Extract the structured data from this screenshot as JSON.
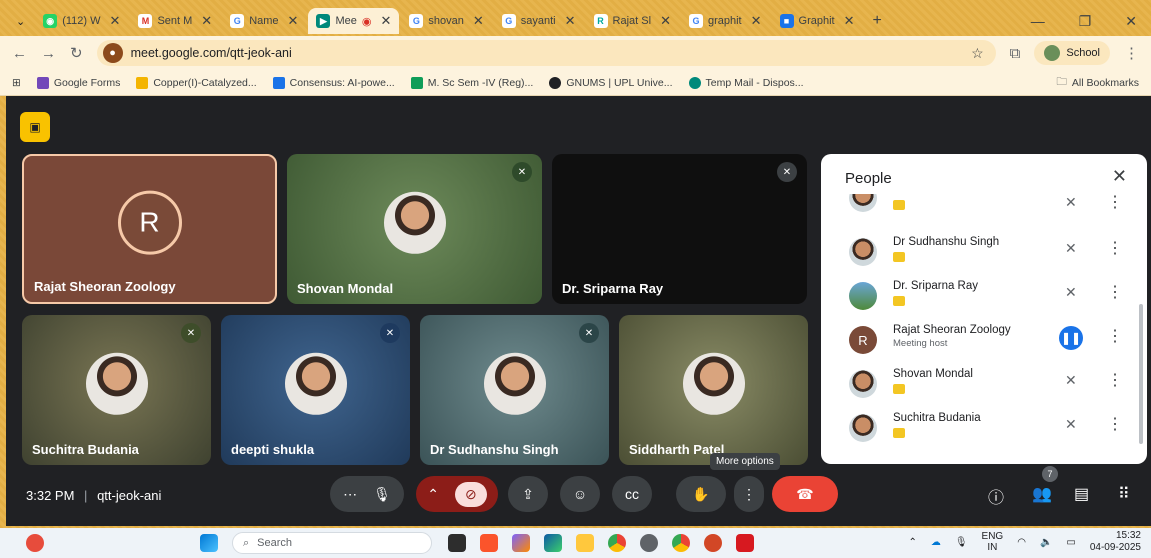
{
  "browser": {
    "tabs": [
      {
        "label": "(112) W",
        "icon": "whatsapp-icon",
        "color": "#25d366"
      },
      {
        "label": "Sent M",
        "icon": "gmail-icon",
        "color": "#d93025"
      },
      {
        "label": "Name",
        "icon": "google-icon",
        "color": "#4285f4"
      },
      {
        "label": "Mee",
        "icon": "meet-icon",
        "color": "#00897b",
        "active": true
      },
      {
        "label": "shovan",
        "icon": "google-icon",
        "color": "#4285f4"
      },
      {
        "label": "sayanti",
        "icon": "google-icon",
        "color": "#4285f4"
      },
      {
        "label": "Rajat Sl",
        "icon": "researchgate-icon",
        "color": "#00ccbb"
      },
      {
        "label": "graphit",
        "icon": "google-icon",
        "color": "#4285f4"
      },
      {
        "label": "Graphit",
        "icon": "lock-icon",
        "color": "#1a73e8"
      }
    ],
    "url": "meet.google.com/qtt-jeok-ani",
    "profile": "School",
    "bookmarks": [
      {
        "label": "Google Forms",
        "color": "#7248b9"
      },
      {
        "label": "Copper(I)-Catalyzed...",
        "color": "#f4b400"
      },
      {
        "label": "Consensus: AI-powe...",
        "color": "#1a73e8"
      },
      {
        "label": "M. Sc Sem -IV (Reg)...",
        "color": "#0f9d58"
      },
      {
        "label": "GNUMS | UPL Unive...",
        "color": "#202124"
      },
      {
        "label": "Temp Mail - Dispos...",
        "color": "#00897b"
      }
    ],
    "all_bookmarks": "All Bookmarks"
  },
  "tiles": [
    {
      "name": "Rajat Sheoran Zoology",
      "initial": "R"
    },
    {
      "name": "Shovan Mondal"
    },
    {
      "name": "Dr. Sriparna Ray"
    },
    {
      "name": "Suchitra Budania"
    },
    {
      "name": "deepti shukla"
    },
    {
      "name": "Dr Sudhanshu Singh"
    },
    {
      "name": "Siddharth Patel"
    }
  ],
  "people_panel": {
    "title": "People",
    "participants": [
      {
        "name": "Dr Sudhanshu Singh"
      },
      {
        "name": "Dr. Sriparna Ray"
      },
      {
        "name": "Rajat Sheoran Zoology",
        "subtitle": "Meeting host",
        "initial": "R"
      },
      {
        "name": "Shovan Mondal"
      },
      {
        "name": "Suchitra Budania"
      }
    ]
  },
  "meeting": {
    "time": "3:32 PM",
    "separator": "|",
    "code": "qtt-jeok-ani",
    "tooltip": "More options",
    "people_count": "7"
  },
  "taskbar": {
    "search": "Search",
    "lang_top": "ENG",
    "lang_bottom": "IN",
    "time": "15:32",
    "date": "04-09-2025"
  },
  "colors": {
    "end_call": "#ea4335",
    "camera_off": "#f9dedc",
    "host_speaking": "#1a73e8"
  }
}
